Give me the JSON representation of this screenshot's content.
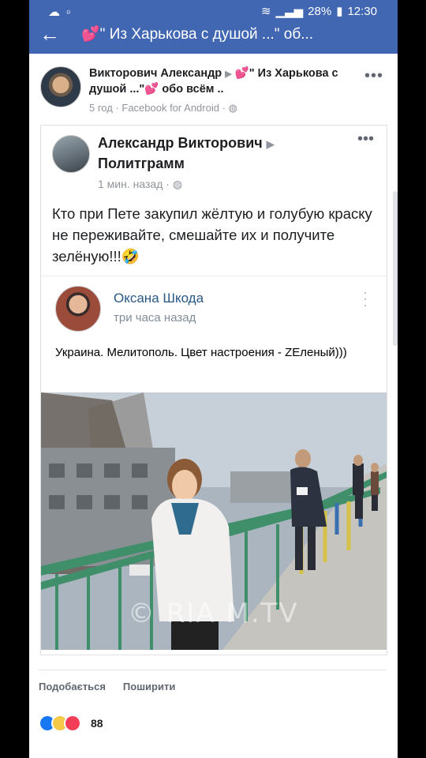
{
  "status_bar": {
    "battery": "28%",
    "time": "12:30",
    "signal": "signal-icon"
  },
  "app_bar": {
    "title": "\" Из Харькова с душой ...\" об..."
  },
  "post": {
    "author": "Викторович Александр",
    "group_line": "\" Из Харькова с душой ...\"",
    "group_tail": "обо всём ..",
    "meta": "5 год · Facebook for Android ·"
  },
  "shared": {
    "author": "Александр Викторович",
    "group": "Политграмм",
    "meta": "1 мин. назад ·",
    "text": "Кто при Пете закупил жёлтую и голубую краску не переживайте, смешайте их и получите зелёную!!!🤣"
  },
  "inner": {
    "author": "Оксана Шкода",
    "meta": "три часа назад",
    "text": "Украина. Мелитополь. Цвет настроения - ZЕленый)))"
  },
  "photo": {
    "watermark": "© RIA M.TV"
  },
  "actions": {
    "like": "Подобається",
    "share": "Поширити"
  },
  "reactions": {
    "count": "88"
  },
  "colors": {
    "brand": "#4267b2",
    "vk_link": "#2a5885"
  }
}
